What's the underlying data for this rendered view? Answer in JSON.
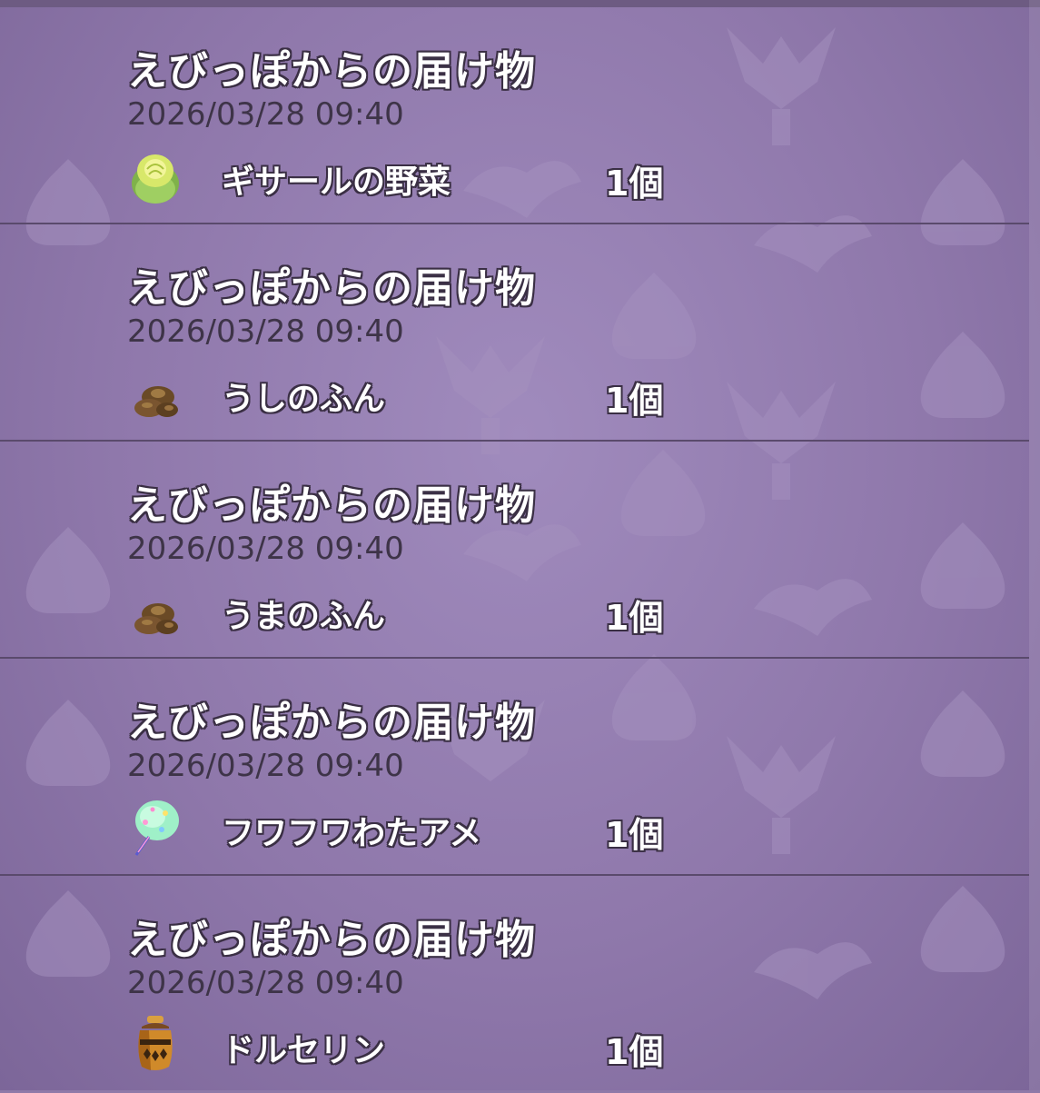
{
  "mail_list": [
    {
      "title": "えびっぽからの届け物",
      "date": "2026/03/28  09:40",
      "item_icon": "cabbage-icon",
      "item_name": "ギサールの野菜",
      "quantity": "1個"
    },
    {
      "title": "えびっぽからの届け物",
      "date": "2026/03/28  09:40",
      "item_icon": "dung-icon",
      "item_name": "うしのふん",
      "quantity": "1個"
    },
    {
      "title": "えびっぽからの届け物",
      "date": "2026/03/28  09:40",
      "item_icon": "dung-icon",
      "item_name": "うまのふん",
      "quantity": "1個"
    },
    {
      "title": "えびっぽからの届け物",
      "date": "2026/03/28  09:40",
      "item_icon": "cotton-candy-icon",
      "item_name": "フワフワわたアメ",
      "quantity": "1個"
    },
    {
      "title": "えびっぽからの届け物",
      "date": "2026/03/28  09:40",
      "item_icon": "jar-icon",
      "item_name": "ドルセリン",
      "quantity": "1個"
    }
  ],
  "colors": {
    "background": "#8f7aa8",
    "divider": "#5a4a6c",
    "date_text": "#3e3448",
    "text_outline": "#3a2f44"
  }
}
